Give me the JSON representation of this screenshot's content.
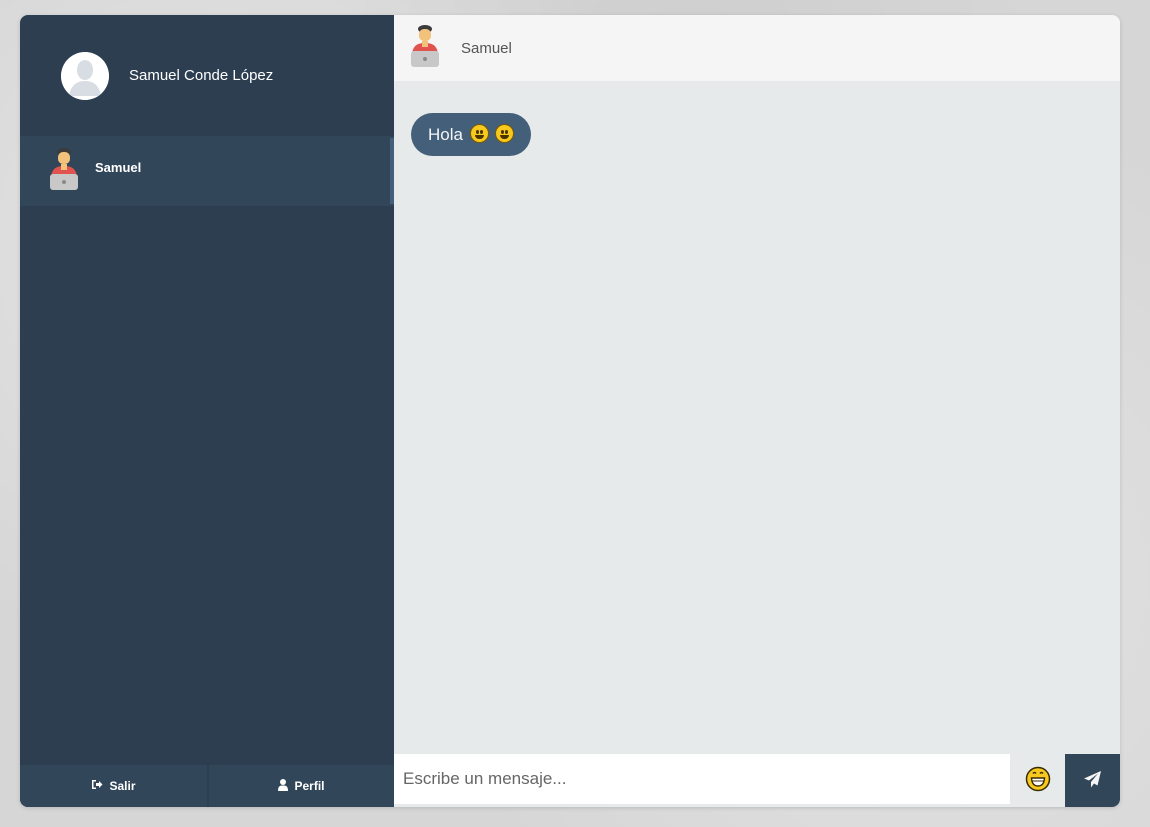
{
  "sidebar": {
    "profile": {
      "name": "Samuel Conde López",
      "avatar_icon": "user-silhouette-icon"
    },
    "contacts": [
      {
        "name": "Samuel",
        "avatar_icon": "person-laptop-icon",
        "active": true
      }
    ],
    "bottom": {
      "logout_label": "Salir",
      "logout_icon": "sign-out-icon",
      "profile_label": "Perfil",
      "profile_icon": "user-icon"
    }
  },
  "chat": {
    "header_name": "Samuel",
    "header_icon": "person-laptop-icon",
    "messages": [
      {
        "text": "Hola",
        "emojis": [
          "smiley-icon",
          "smiley-icon"
        ]
      }
    ],
    "composer": {
      "placeholder": "Escribe un mensaje...",
      "emoji_icon": "grinning-face-icon",
      "send_icon": "paper-plane-icon"
    }
  },
  "colors": {
    "sidebar_bg": "#2c3e50",
    "sidebar_item_bg": "#32465a",
    "bubble_bg": "#435f7a",
    "content_bg": "#e6eaea",
    "header_bg": "#f5f5f5"
  }
}
